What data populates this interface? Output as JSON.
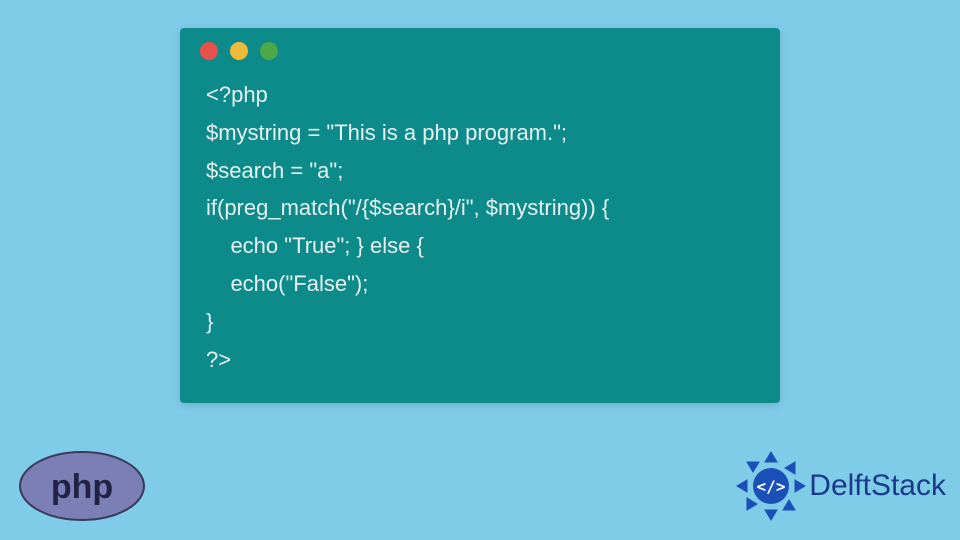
{
  "code": {
    "lines": [
      "<?php",
      "$mystring = \"This is a php program.\";",
      "$search = \"a\";",
      "if(preg_match(\"/{$search}/i\", $mystring)) {",
      "    echo \"True\"; } else {",
      "    echo(\"False\");",
      "}",
      "?>"
    ]
  },
  "badges": {
    "php_label": "php",
    "brand_name": "DelftStack"
  },
  "colors": {
    "background": "#7fcce8",
    "window_bg": "#0d8b8b",
    "code_text": "#e8f0f0",
    "dot_red": "#e9524a",
    "dot_yellow": "#f0b93a",
    "dot_green": "#4ca848",
    "php_badge_bg": "#7b7fb5",
    "php_badge_text": "#222244",
    "delft_blue": "#1a3a8a"
  }
}
